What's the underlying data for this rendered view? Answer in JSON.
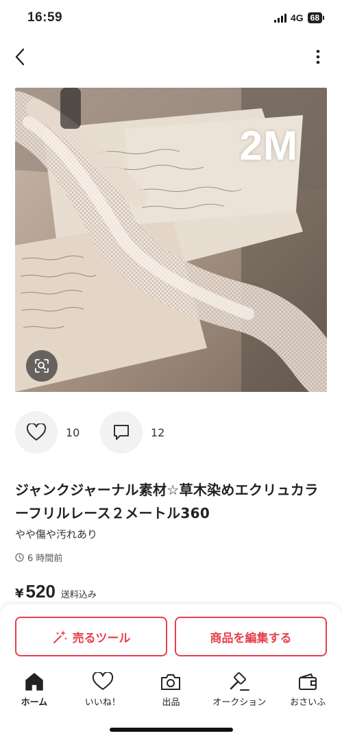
{
  "status_bar": {
    "time": "16:59",
    "network": "4G",
    "battery": "68"
  },
  "nav": {
    "back_icon": "chevron-left-icon",
    "menu_icon": "more-vertical-icon"
  },
  "product": {
    "image_label": "2M",
    "likes": "10",
    "comments": "12",
    "title": "ジャンクジャーナル素材☆草木染めエクリュカラーフリルレース２メートル360",
    "condition": "やや傷や汚れあり",
    "posted": "6 時間前",
    "price_symbol": "¥",
    "price": "520",
    "shipping_note": "送料込み"
  },
  "actions": {
    "sell_tool": "売るツール",
    "edit_item": "商品を編集する"
  },
  "tabs": [
    {
      "label": "ホーム",
      "icon": "home-icon",
      "active": true
    },
    {
      "label": "いいね！",
      "icon": "heart-icon",
      "active": false
    },
    {
      "label": "出品",
      "icon": "camera-icon",
      "active": false
    },
    {
      "label": "オークション",
      "icon": "auction-hammer-icon",
      "active": false
    },
    {
      "label": "おさいふ",
      "icon": "wallet-icon",
      "active": false
    }
  ],
  "colors": {
    "accent": "#e8404a",
    "text": "#222222",
    "reaction_bg": "#f2f2f2"
  }
}
